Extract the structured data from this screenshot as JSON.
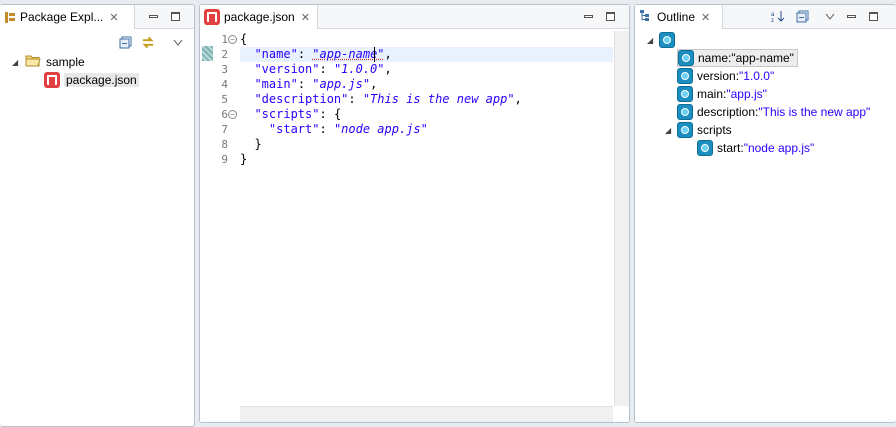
{
  "package_explorer": {
    "tab_label": "Package Expl...",
    "tree": {
      "project": "sample",
      "file": "package.json"
    }
  },
  "editor": {
    "tab_label": "package.json",
    "lines": [
      {
        "num": "1",
        "text": "{"
      },
      {
        "num": "2",
        "key": "\"name\"",
        "sep": ": ",
        "val": "\"app-name\"",
        "end": ","
      },
      {
        "num": "3",
        "key": "\"version\"",
        "sep": ": ",
        "val": "\"1.0.0\"",
        "end": ","
      },
      {
        "num": "4",
        "key": "\"main\"",
        "sep": ": ",
        "val": "\"app.js\"",
        "end": ","
      },
      {
        "num": "5",
        "key": "\"description\"",
        "sep": ": ",
        "val": "\"This is the new app\"",
        "end": ","
      },
      {
        "num": "6",
        "key": "\"scripts\"",
        "sep": ": ",
        "val": "",
        "end": "{"
      },
      {
        "num": "7",
        "key": "\"start\"",
        "sep": ": ",
        "val": "\"node app.js\"",
        "end": ""
      },
      {
        "num": "8",
        "text": "  }"
      },
      {
        "num": "9",
        "text": "}"
      }
    ]
  },
  "outline": {
    "tab_label": "Outline",
    "items": [
      {
        "key": "name",
        "sep": " : ",
        "val": "\"app-name\""
      },
      {
        "key": "version",
        "sep": " : ",
        "val": "\"1.0.0\""
      },
      {
        "key": "main",
        "sep": " : ",
        "val": "\"app.js\""
      },
      {
        "key": "description",
        "sep": " : ",
        "val": "\"This is the new app\""
      },
      {
        "key": "scripts",
        "sep": "",
        "val": ""
      },
      {
        "key": "start",
        "sep": " : ",
        "val": "\"node app.js\""
      }
    ]
  },
  "colors": {
    "string": "#2a00ff",
    "json_icon": "#e04040",
    "outline_icon": "#1c8dbf"
  }
}
